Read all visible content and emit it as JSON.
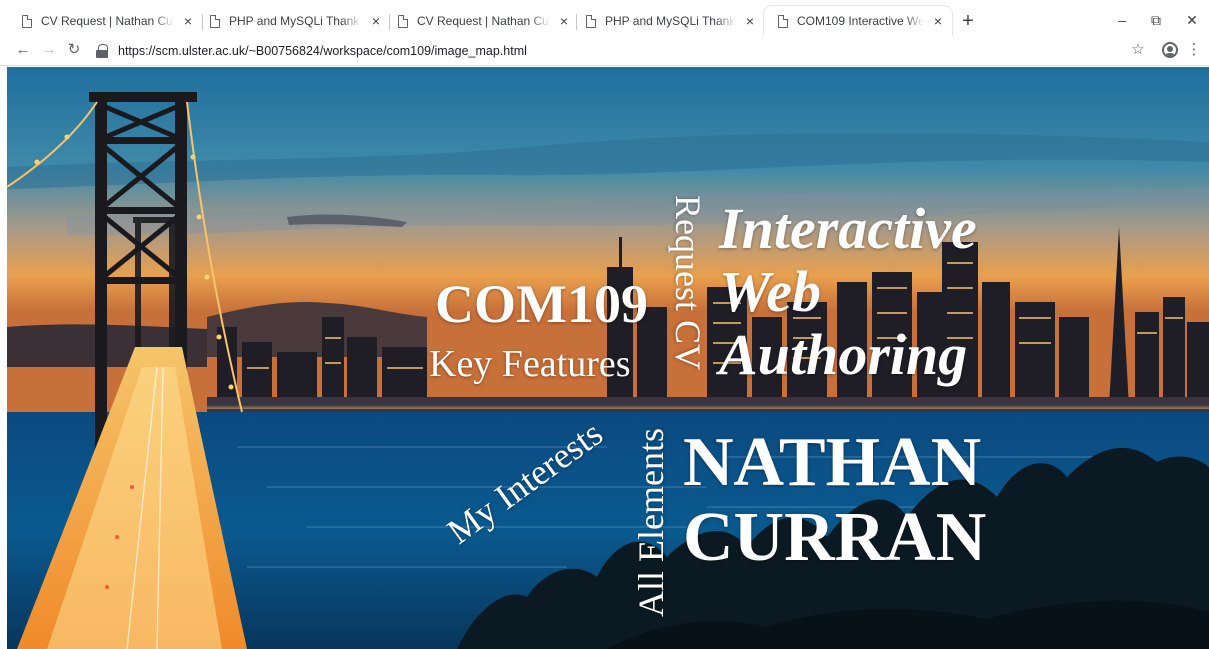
{
  "browser": {
    "tabs": [
      {
        "title": "CV Request | Nathan Curran",
        "active": false
      },
      {
        "title": "PHP and MySQLi Thank you message",
        "active": false
      },
      {
        "title": "CV Request | Nathan Curran",
        "active": false
      },
      {
        "title": "PHP and MySQLi Thank you message",
        "active": false
      },
      {
        "title": "COM109 Interactive Web Authoring",
        "active": true
      }
    ],
    "new_tab_glyph": "+",
    "close_glyph": "×",
    "window_controls": {
      "minimize": "–",
      "maximize": "⧉",
      "close": "✕"
    },
    "nav": {
      "back": "←",
      "forward": "→",
      "reload": "↻"
    },
    "url": "https://scm.ulster.ac.uk/~B00756824/workspace/com109/image_map.html",
    "bookmark_glyph": "☆",
    "menu_glyph": "⋮"
  },
  "page": {
    "links": {
      "com109": "COM109",
      "key_features": "Key Features",
      "my_interests": "My Interests",
      "all_elements": "All Elements",
      "request_cv": "Request CV"
    },
    "heading_lines": [
      "Interactive",
      "Web",
      "Authoring"
    ],
    "name_lines": [
      "NATHAN",
      "CURRAN"
    ]
  }
}
